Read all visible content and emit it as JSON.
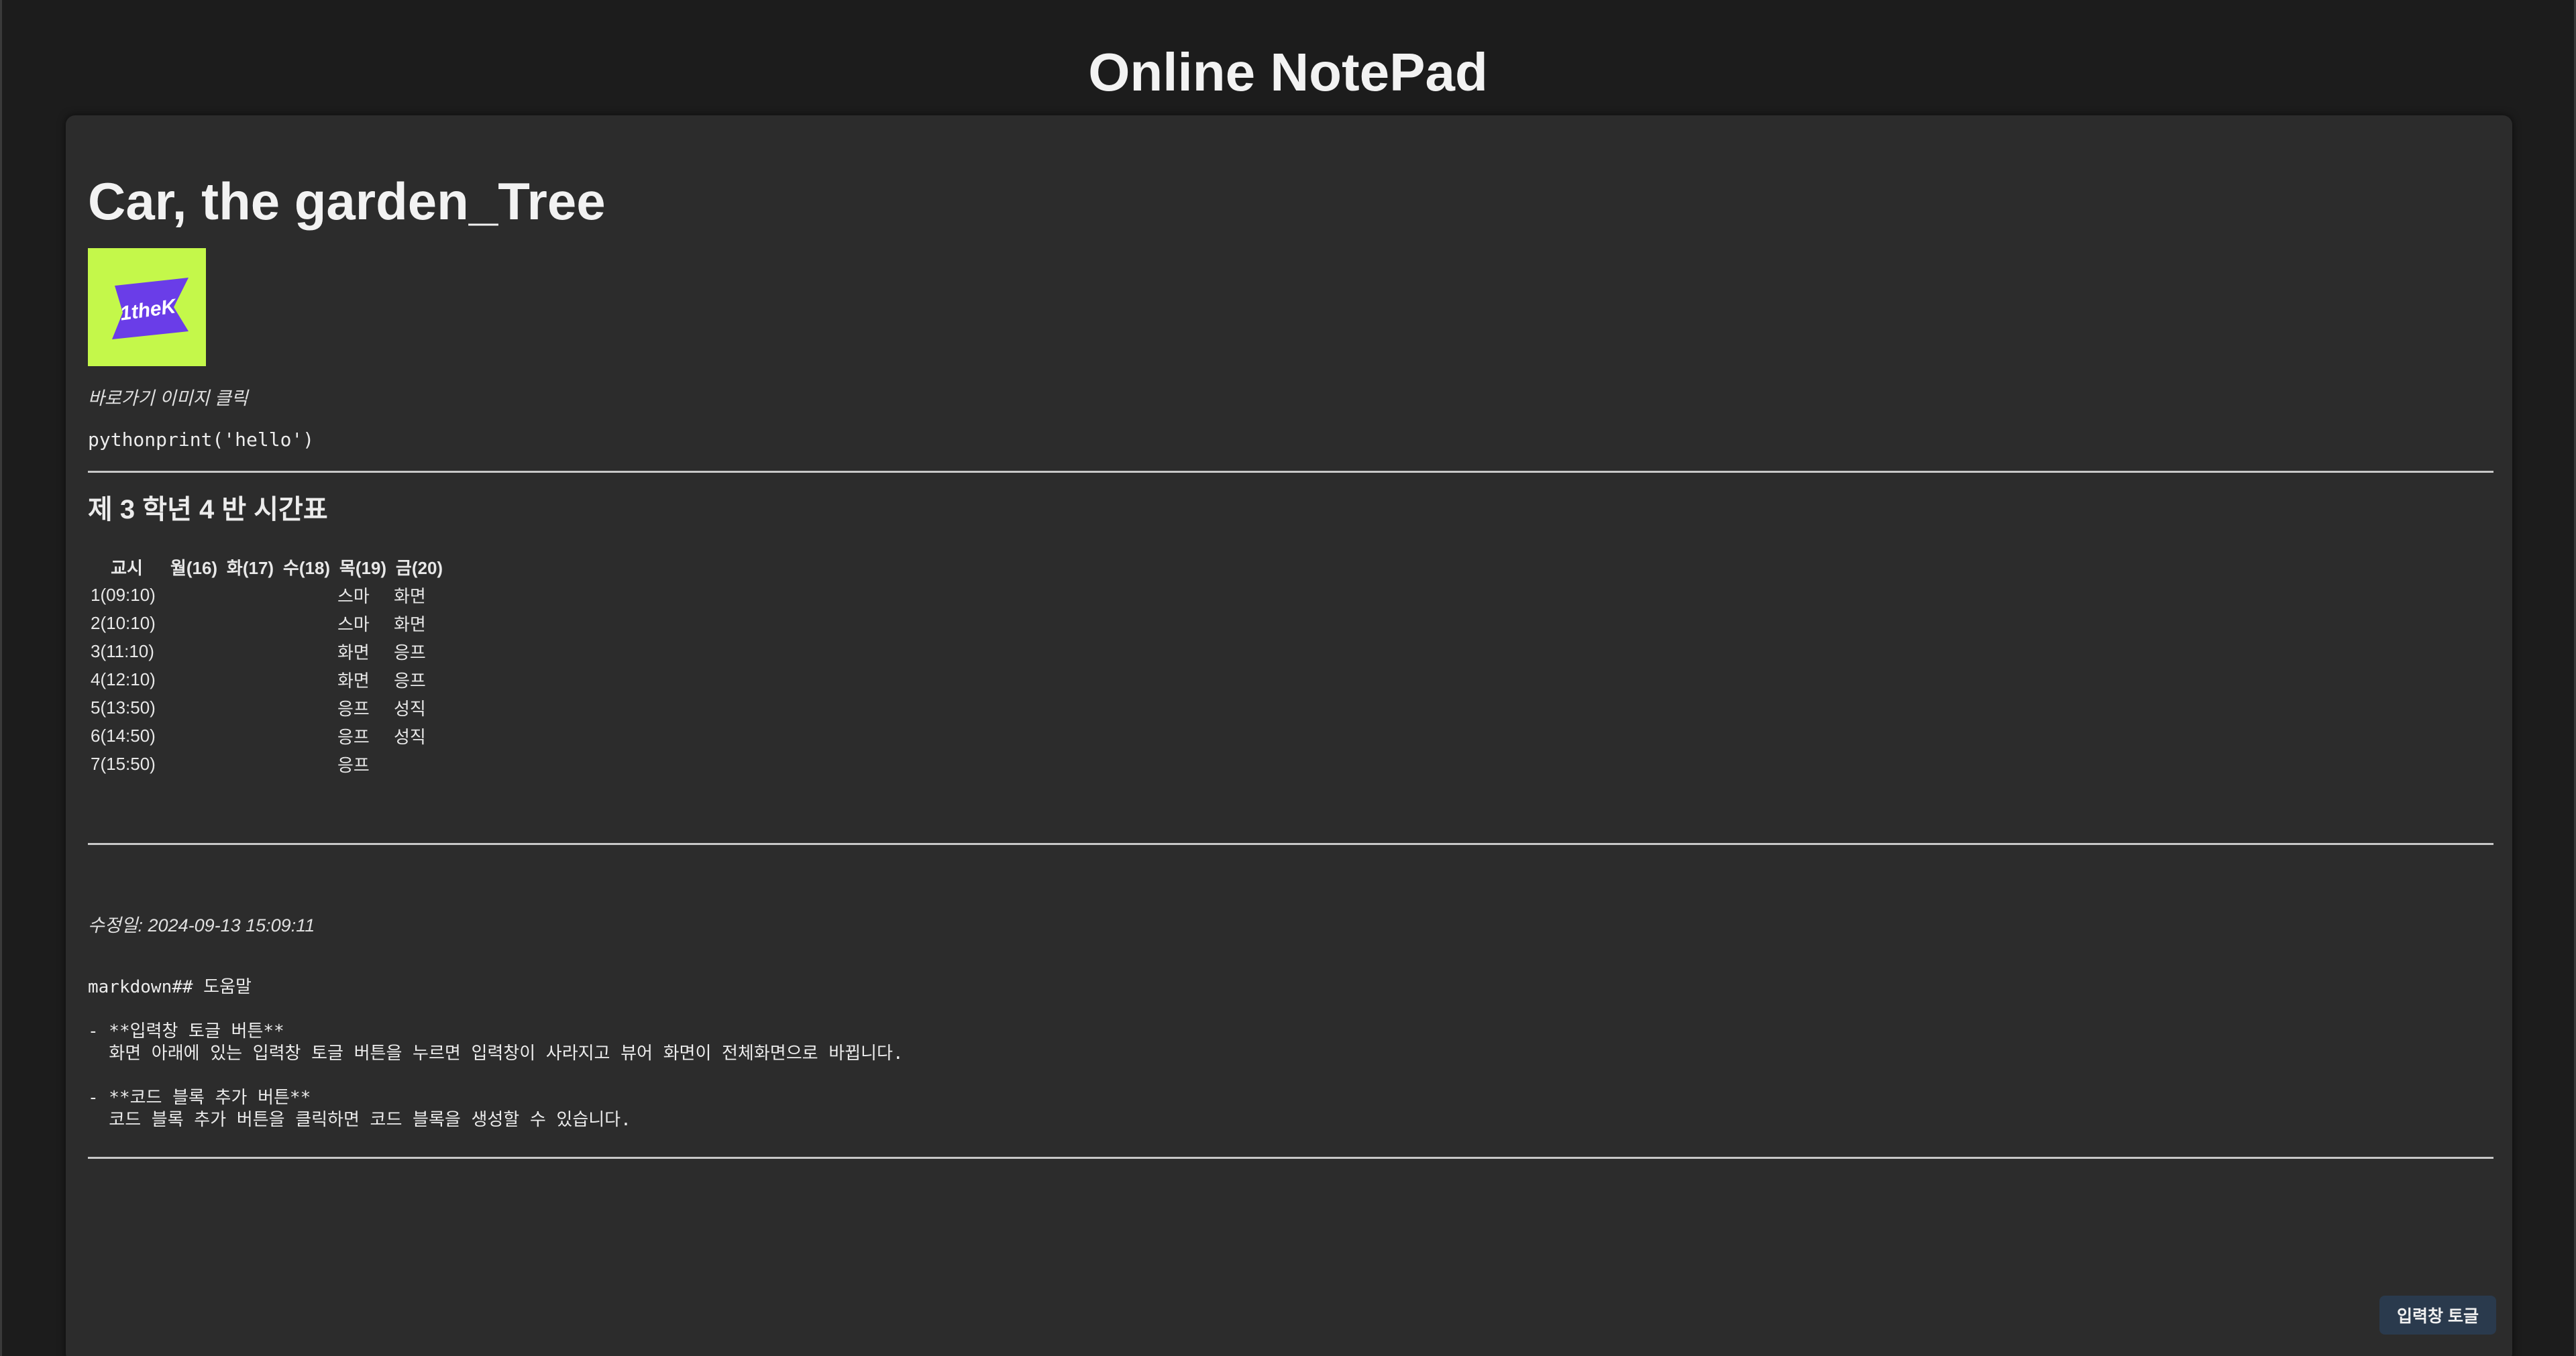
{
  "app": {
    "title": "Online NotePad"
  },
  "document": {
    "title": "Car, the garden_Tree",
    "logo": {
      "text": "1theK",
      "background_color": "#c4f84a",
      "flag_color": "#6a3de8",
      "text_color": "#ffffff"
    },
    "logo_caption": "바로가기 이미지 클릭",
    "code_line": "pythonprint('hello')",
    "timetable": {
      "heading": "제 3 학년 4 반 시간표",
      "headers": [
        "교시",
        "월(16)",
        "화(17)",
        "수(18)",
        "목(19)",
        "금(20)"
      ],
      "rows": [
        [
          "1(09:10)",
          "",
          "",
          "",
          "스마",
          "화면"
        ],
        [
          "2(10:10)",
          "",
          "",
          "",
          "스마",
          "화면"
        ],
        [
          "3(11:10)",
          "",
          "",
          "",
          "화면",
          "응프"
        ],
        [
          "4(12:10)",
          "",
          "",
          "",
          "화면",
          "응프"
        ],
        [
          "5(13:50)",
          "",
          "",
          "",
          "응프",
          "성직"
        ],
        [
          "6(14:50)",
          "",
          "",
          "",
          "응프",
          "성직"
        ],
        [
          "7(15:50)",
          "",
          "",
          "",
          "응프",
          ""
        ]
      ]
    },
    "modified": "수정일: 2024-09-13 15:09:11",
    "help_text": "markdown## 도움말\n\n- **입력창 토글 버튼**\n  화면 아래에 있는 입력창 토글 버튼을 누르면 입력창이 사라지고 뷰어 화면이 전체화면으로 바뀝니다.\n\n- **코드 블록 추가 버튼**\n  코드 블록 추가 버튼을 클릭하면 코드 블록을 생성할 수 있습니다."
  },
  "controls": {
    "toggle_input_label": "입력창 토글"
  }
}
